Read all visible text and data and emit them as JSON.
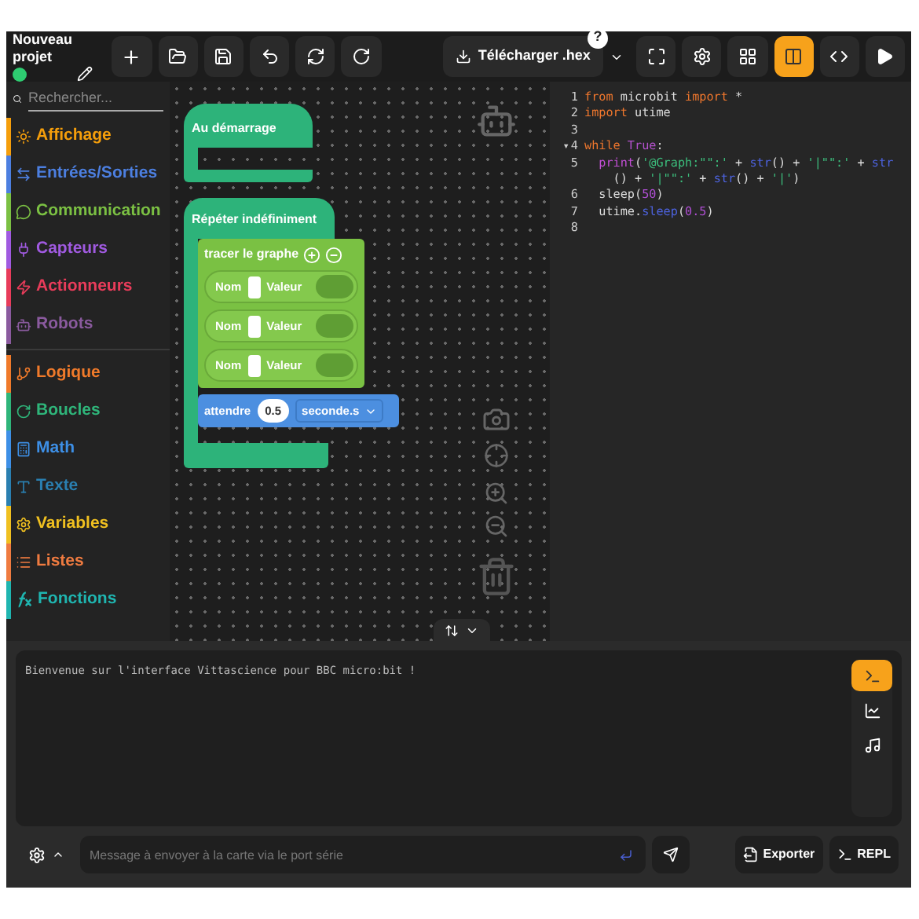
{
  "project": {
    "title": "Nouveau projet",
    "connected": true
  },
  "toolbar": {
    "download": {
      "label": "Télécharger .hex",
      "help": "?"
    },
    "view_modes": [
      {
        "selected": false
      },
      {
        "selected": true
      },
      {
        "selected": false
      }
    ]
  },
  "search": {
    "placeholder": "Rechercher..."
  },
  "categories": [
    {
      "label": "Affichage",
      "color": "#f59e0b"
    },
    {
      "label": "Entrées/Sorties",
      "color": "#4c7fe0"
    },
    {
      "label": "Communication",
      "color": "#7bc043"
    },
    {
      "label": "Capteurs",
      "color": "#a05ae0"
    },
    {
      "label": "Actionneurs",
      "color": "#e83c5a"
    },
    {
      "label": "Robots",
      "color": "#8a5a9e"
    },
    {
      "label": "Logique",
      "color": "#f07a2a"
    },
    {
      "label": "Boucles",
      "color": "#2fb57a"
    },
    {
      "label": "Math",
      "color": "#3d8fe6"
    },
    {
      "label": "Texte",
      "color": "#2a7fb0"
    },
    {
      "label": "Variables",
      "color": "#f0c020"
    },
    {
      "label": "Listes",
      "color": "#ef7b40"
    },
    {
      "label": "Fonctions",
      "color": "#1fb5b0"
    }
  ],
  "blocks": {
    "start": "Au démarrage",
    "forever": "Répéter indéfiniment",
    "graph": {
      "label": "tracer le graphe",
      "rows": [
        {
          "name": "Nom",
          "value": "Valeur"
        },
        {
          "name": "Nom",
          "value": "Valeur"
        },
        {
          "name": "Nom",
          "value": "Valeur"
        }
      ]
    },
    "wait": {
      "label": "attendre",
      "value": "0.5",
      "unit": "seconde.s"
    }
  },
  "code": {
    "lines": [
      {
        "number": "1",
        "tokens": [
          {
            "kind": "keyword",
            "text": "from"
          },
          {
            "kind": "plain",
            "text": " microbit "
          },
          {
            "kind": "keyword",
            "text": "import"
          },
          {
            "kind": "plain",
            "text": " *"
          }
        ]
      },
      {
        "number": "2",
        "tokens": [
          {
            "kind": "keyword",
            "text": "import"
          },
          {
            "kind": "plain",
            "text": " utime"
          }
        ]
      },
      {
        "number": "3"
      },
      {
        "number": "4",
        "fold": "▾",
        "tokens": [
          {
            "kind": "keyword",
            "text": "while"
          },
          {
            "kind": "constant",
            "text": " True"
          },
          {
            "kind": "plain",
            "text": ":"
          }
        ]
      },
      {
        "number": "5",
        "tokens": [
          {
            "kind": "func",
            "text": "  print"
          },
          {
            "kind": "plain",
            "text": "("
          },
          {
            "kind": "string",
            "text": "'@Graph:\"\":'"
          },
          {
            "kind": "plain",
            "text": " + "
          },
          {
            "kind": "builtin",
            "text": "str"
          },
          {
            "kind": "plain",
            "text": "() + "
          },
          {
            "kind": "string",
            "text": "'|\"\":'"
          },
          {
            "kind": "plain",
            "text": " + "
          },
          {
            "kind": "builtin",
            "text": "str"
          }
        ]
      },
      {
        "tokens": [
          {
            "kind": "plain",
            "text": "    () + "
          },
          {
            "kind": "string",
            "text": "'|\"\":'"
          },
          {
            "kind": "plain",
            "text": " + "
          },
          {
            "kind": "builtin",
            "text": "str"
          },
          {
            "kind": "plain",
            "text": "() + "
          },
          {
            "kind": "string",
            "text": "'|'"
          },
          {
            "kind": "plain",
            "text": ")"
          }
        ]
      },
      {
        "number": "6",
        "tokens": [
          {
            "kind": "plain",
            "text": "  sleep("
          },
          {
            "kind": "number",
            "text": "50"
          },
          {
            "kind": "plain",
            "text": ")"
          }
        ]
      },
      {
        "number": "7",
        "tokens": [
          {
            "kind": "plain",
            "text": "  utime."
          },
          {
            "kind": "builtin",
            "text": "sleep"
          },
          {
            "kind": "plain",
            "text": "("
          },
          {
            "kind": "number",
            "text": "0.5"
          },
          {
            "kind": "plain",
            "text": ")"
          }
        ]
      },
      {
        "number": "8"
      }
    ]
  },
  "console": {
    "text": "Bienvenue sur l'interface Vittascience pour BBC micro:bit !",
    "tabs": [
      {
        "selected": true
      },
      {
        "selected": false
      },
      {
        "selected": false
      }
    ]
  },
  "serial": {
    "placeholder": "Message à envoyer à la carte via le port série",
    "export": "Exporter",
    "repl": "REPL"
  }
}
